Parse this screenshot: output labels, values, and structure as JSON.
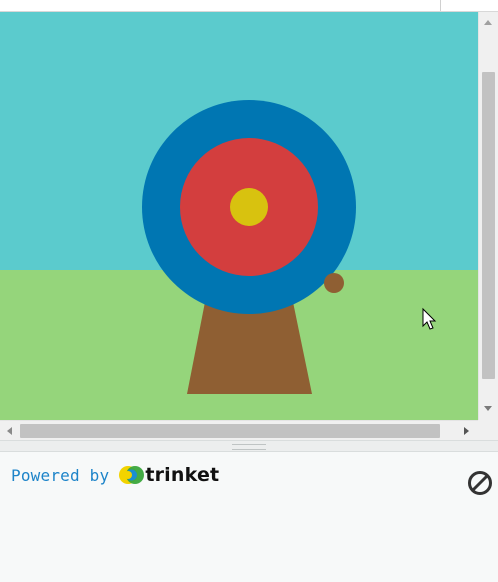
{
  "footer": {
    "powered_label": "Powered by",
    "brand_name": "trinket",
    "brand_logo_icon": "trinket-logo-icon",
    "stop_icon": "stop-circle-icon"
  },
  "scene": {
    "sky_color": "#5bcbcd",
    "grass_color": "#95d57b",
    "stand_color": "#8f5f33",
    "target_rings": [
      {
        "name": "outer",
        "color": "#0076b2"
      },
      {
        "name": "middle",
        "color": "#d33e3e"
      },
      {
        "name": "bullseye",
        "color": "#d8c20f"
      }
    ],
    "arrow_color": "#8f5f33"
  },
  "colors": {
    "link_blue": "#1d84c9",
    "footer_bg": "#f7f9f9"
  }
}
